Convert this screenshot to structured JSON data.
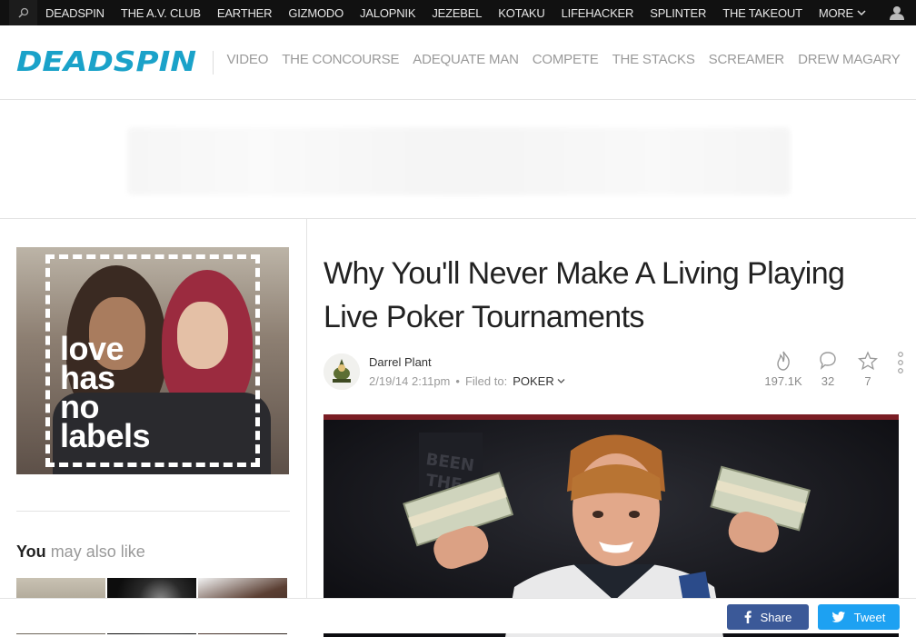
{
  "network": {
    "links": [
      "DEADSPIN",
      "THE A.V. CLUB",
      "EARTHER",
      "GIZMODO",
      "JALOPNIK",
      "JEZEBEL",
      "KOTAKU",
      "LIFEHACKER",
      "SPLINTER",
      "THE TAKEOUT"
    ],
    "more_label": "MORE"
  },
  "site": {
    "logo_text": "DEADSPIN",
    "sections": [
      "VIDEO",
      "THE CONCOURSE",
      "ADEQUATE MAN",
      "COMPETE",
      "THE STACKS",
      "SCREAMER",
      "DREW MAGARY"
    ]
  },
  "sidebar": {
    "promo_caption": [
      "love",
      "has",
      "no",
      "labels"
    ],
    "also_bold": "You",
    "also_rest": "may also like"
  },
  "article": {
    "headline": "Why You'll Never Make A Living Playing Live Poker Tournaments",
    "author": "Darrel Plant",
    "date": "2/19/14 2:11pm",
    "filed_label": "Filed to:",
    "tag": "POKER",
    "views": "197.1K",
    "comments": "32",
    "stars": "7"
  },
  "share": {
    "facebook_label": "Share",
    "twitter_label": "Tweet"
  },
  "colors": {
    "brand": "#1aa2c9",
    "facebook": "#3b5998",
    "twitter": "#1da1f2",
    "netbar": "#111111"
  },
  "icons": [
    "search-icon",
    "chevron-down-icon",
    "user-icon",
    "flame-icon",
    "comment-icon",
    "star-icon",
    "more-vertical-icon",
    "facebook-icon",
    "twitter-icon"
  ]
}
